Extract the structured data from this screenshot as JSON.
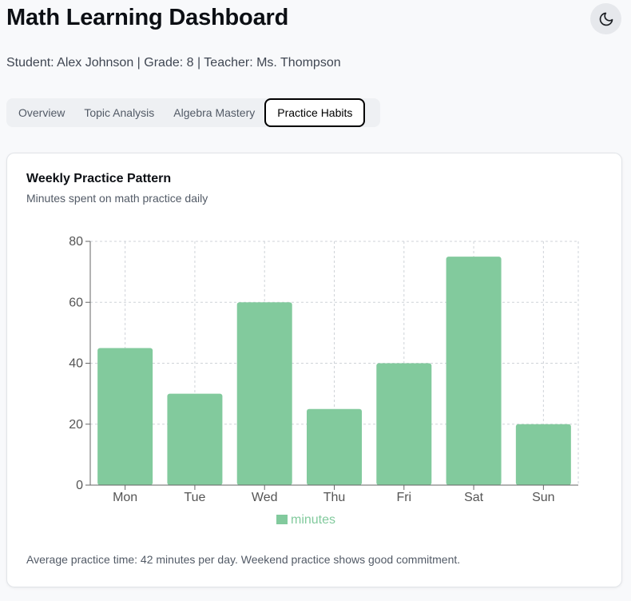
{
  "header": {
    "title": "Math Learning Dashboard",
    "theme_toggle_icon": "moon-icon",
    "student_info": "Student: Alex Johnson | Grade: 8 | Teacher: Ms. Thompson"
  },
  "tabs": [
    {
      "label": "Overview",
      "active": false
    },
    {
      "label": "Topic Analysis",
      "active": false
    },
    {
      "label": "Algebra Mastery",
      "active": false
    },
    {
      "label": "Practice Habits",
      "active": true
    }
  ],
  "card": {
    "title": "Weekly Practice Pattern",
    "subtitle": "Minutes spent on math practice daily",
    "footnote": "Average practice time: 42 minutes per day. Weekend practice shows good commitment."
  },
  "chart_data": {
    "type": "bar",
    "categories": [
      "Mon",
      "Tue",
      "Wed",
      "Thu",
      "Fri",
      "Sat",
      "Sun"
    ],
    "series": [
      {
        "name": "minutes",
        "values": [
          45,
          30,
          60,
          25,
          40,
          75,
          20
        ]
      }
    ],
    "ylim": [
      0,
      80
    ],
    "yticks": [
      0,
      20,
      40,
      60,
      80
    ],
    "grid": true,
    "legend": "bottom",
    "bar_color": "#82ca9d"
  }
}
